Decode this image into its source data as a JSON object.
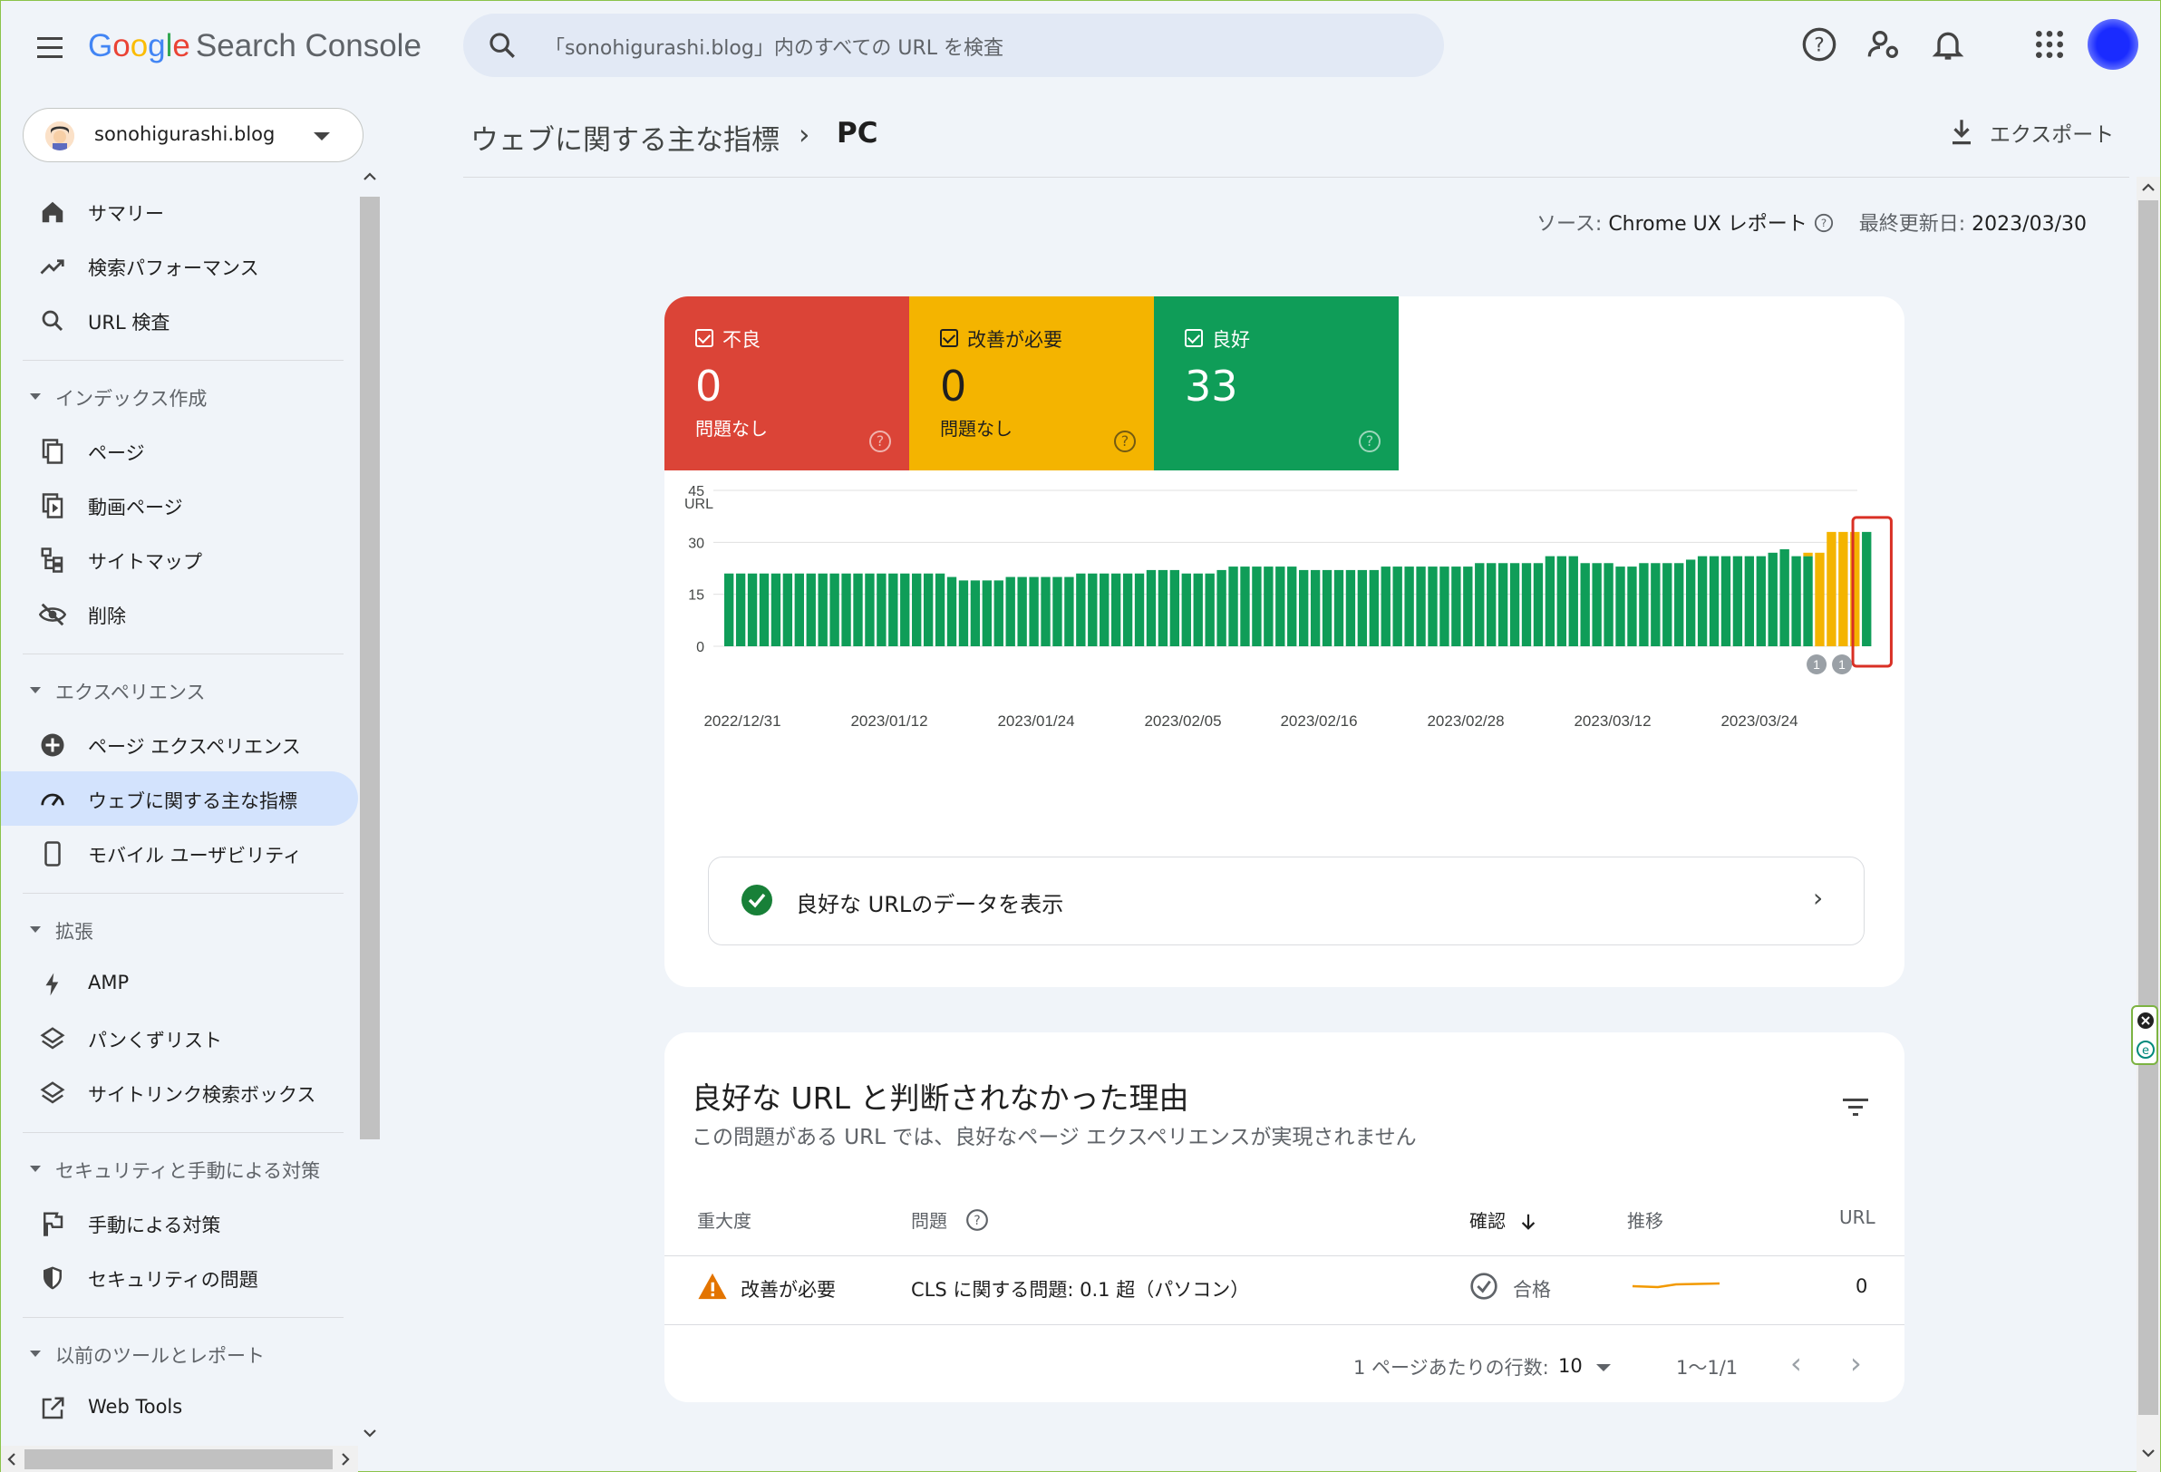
{
  "header": {
    "logo_google": [
      "G",
      "o",
      "o",
      "g",
      "l",
      "e"
    ],
    "logo_product": "Search Console",
    "search_placeholder": "「sonohigurashi.blog」内のすべての URL を検査",
    "icons": [
      "help-icon",
      "manage-users-icon",
      "notifications-icon",
      "apps-icon"
    ]
  },
  "sidebar": {
    "property": "sonohigurashi.blog",
    "items": [
      {
        "label": "サマリー",
        "icon": "home-icon"
      },
      {
        "label": "検索パフォーマンス",
        "icon": "trending-up-icon"
      },
      {
        "label": "URL 検査",
        "icon": "search-icon"
      }
    ],
    "sections": [
      {
        "title": "インデックス作成",
        "items": [
          {
            "label": "ページ",
            "icon": "pages-icon"
          },
          {
            "label": "動画ページ",
            "icon": "video-page-icon"
          },
          {
            "label": "サイトマップ",
            "icon": "sitemap-icon"
          },
          {
            "label": "削除",
            "icon": "visibility-off-icon"
          }
        ]
      },
      {
        "title": "エクスペリエンス",
        "items": [
          {
            "label": "ページ エクスペリエンス",
            "icon": "plus-circle-icon"
          },
          {
            "label": "ウェブに関する主な指標",
            "icon": "speed-icon",
            "active": true
          },
          {
            "label": "モバイル ユーザビリティ",
            "icon": "phone-icon"
          }
        ]
      },
      {
        "title": "拡張",
        "items": [
          {
            "label": "AMP",
            "icon": "bolt-icon"
          },
          {
            "label": "パンくずリスト",
            "icon": "layers-icon"
          },
          {
            "label": "サイトリンク検索ボックス",
            "icon": "layers-icon"
          }
        ]
      },
      {
        "title": "セキュリティと手動による対策",
        "items": [
          {
            "label": "手動による対策",
            "icon": "flag-icon"
          },
          {
            "label": "セキュリティの問題",
            "icon": "shield-icon"
          }
        ]
      },
      {
        "title": "以前のツールとレポート",
        "items": [
          {
            "label": "Web Tools",
            "icon": "open-in-new-icon"
          }
        ]
      }
    ]
  },
  "main": {
    "breadcrumb": [
      "ウェブに関する主な指標",
      "PC"
    ],
    "export_label": "エクスポート",
    "source_label": "ソース:",
    "source_value": "Chrome UX レポート",
    "updated_label": "最終更新日:",
    "updated_value": "2023/03/30"
  },
  "tiles": [
    {
      "label": "不良",
      "value": "0",
      "sub": "問題なし",
      "color": "#db4437"
    },
    {
      "label": "改善が必要",
      "value": "0",
      "sub": "問題なし",
      "color": "#f4b400",
      "text_color": "#1f1f1f"
    },
    {
      "label": "良好",
      "value": "33",
      "sub": "",
      "color": "#0f9d58"
    }
  ],
  "chart_data": {
    "type": "bar",
    "ylabel": "URL",
    "ylim": [
      0,
      45
    ],
    "yticks": [
      0,
      15,
      30,
      45
    ],
    "x_tick_labels": [
      "2022/12/31",
      "2023/01/12",
      "2023/01/24",
      "2023/02/05",
      "2023/02/16",
      "2023/02/28",
      "2023/03/12",
      "2023/03/24"
    ],
    "series": [
      {
        "name": "良好",
        "color": "#0f9d58",
        "values": [
          21,
          21,
          21,
          21,
          21,
          21,
          21,
          21,
          21,
          21,
          21,
          21,
          21,
          21,
          21,
          21,
          21,
          21,
          21,
          20,
          19,
          19,
          19,
          19,
          20,
          20,
          20,
          20,
          20,
          20,
          21,
          21,
          21,
          21,
          21,
          21,
          22,
          22,
          22,
          21,
          21,
          21,
          22,
          23,
          23,
          23,
          23,
          23,
          23,
          22,
          22,
          22,
          22,
          22,
          22,
          22,
          23,
          23,
          23,
          23,
          23,
          23,
          23,
          23,
          24,
          24,
          24,
          24,
          24,
          24,
          26,
          26,
          26,
          24,
          24,
          24,
          23,
          23,
          24,
          24,
          24,
          24,
          25,
          26,
          26,
          26,
          26,
          26,
          26,
          27,
          28,
          26,
          26,
          0,
          0,
          0,
          0,
          33
        ]
      },
      {
        "name": "改善が必要",
        "color": "#f4b400",
        "values": [
          0,
          0,
          0,
          0,
          0,
          0,
          0,
          0,
          0,
          0,
          0,
          0,
          0,
          0,
          0,
          0,
          0,
          0,
          0,
          0,
          0,
          0,
          0,
          0,
          0,
          0,
          0,
          0,
          0,
          0,
          0,
          0,
          0,
          0,
          0,
          0,
          0,
          0,
          0,
          0,
          0,
          0,
          0,
          0,
          0,
          0,
          0,
          0,
          0,
          0,
          0,
          0,
          0,
          0,
          0,
          0,
          0,
          0,
          0,
          0,
          0,
          0,
          0,
          0,
          0,
          0,
          0,
          0,
          0,
          0,
          0,
          0,
          0,
          0,
          0,
          0,
          0,
          0,
          0,
          0,
          0,
          0,
          0,
          0,
          0,
          0,
          0,
          0,
          0,
          0,
          0,
          0,
          1,
          27,
          33,
          33,
          33,
          0
        ]
      }
    ],
    "annotation_markers": [
      "1",
      "1"
    ],
    "highlight": "last bar"
  },
  "good_link": "良好な URLのデータを表示",
  "reasons": {
    "title": "良好な URL と判断されなかった理由",
    "subtitle": "この問題がある URL では、良好なページ エクスペリエンスが実現されません",
    "columns": [
      "重大度",
      "問題",
      "確認",
      "推移",
      "URL"
    ],
    "rows": [
      {
        "severity": "改善が必要",
        "issue": "CLS に関する問題: 0.1 超（パソコン）",
        "validation": "合格",
        "urls": "0"
      }
    ],
    "pager": {
      "rows_label": "1 ページあたりの行数:",
      "rows_value": "10",
      "range": "1〜1/1"
    }
  }
}
